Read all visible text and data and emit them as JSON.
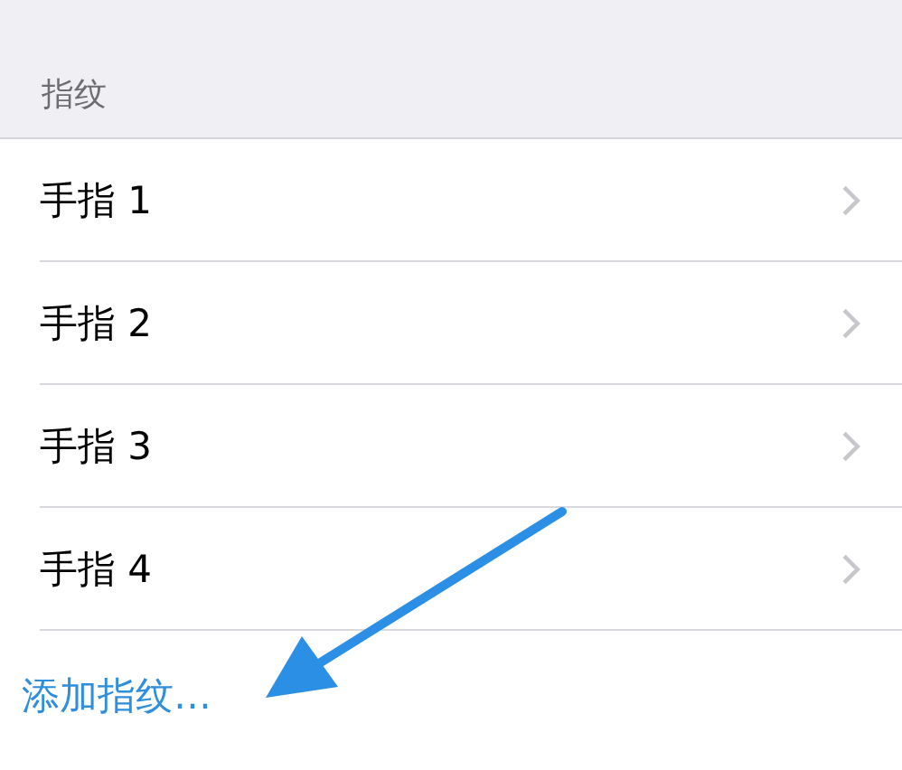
{
  "section": {
    "header": "指纹"
  },
  "rows": [
    {
      "label": "手指 1"
    },
    {
      "label": "手指 2"
    },
    {
      "label": "手指 3"
    },
    {
      "label": "手指 4"
    }
  ],
  "add_action": {
    "label": "添加指纹…"
  },
  "annotation": {
    "kind": "arrow"
  }
}
